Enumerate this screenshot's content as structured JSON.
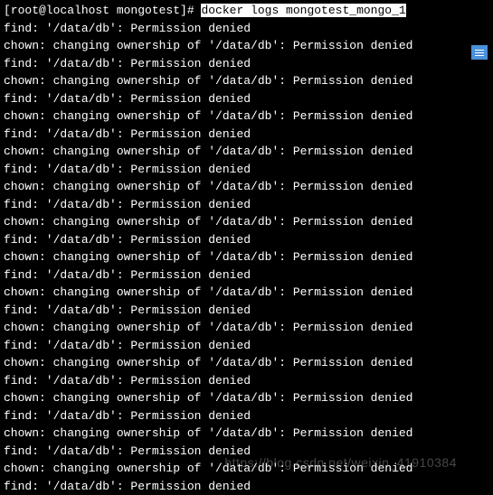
{
  "prompt": {
    "text": "[root@localhost mongotest]# ",
    "command": "docker logs mongotest_mongo_1"
  },
  "lines": [
    "find: '/data/db': Permission denied",
    "chown: changing ownership of '/data/db': Permission denied",
    "find: '/data/db': Permission denied",
    "chown: changing ownership of '/data/db': Permission denied",
    "find: '/data/db': Permission denied",
    "chown: changing ownership of '/data/db': Permission denied",
    "find: '/data/db': Permission denied",
    "chown: changing ownership of '/data/db': Permission denied",
    "find: '/data/db': Permission denied",
    "chown: changing ownership of '/data/db': Permission denied",
    "find: '/data/db': Permission denied",
    "chown: changing ownership of '/data/db': Permission denied",
    "find: '/data/db': Permission denied",
    "chown: changing ownership of '/data/db': Permission denied",
    "find: '/data/db': Permission denied",
    "chown: changing ownership of '/data/db': Permission denied",
    "find: '/data/db': Permission denied",
    "chown: changing ownership of '/data/db': Permission denied",
    "find: '/data/db': Permission denied",
    "chown: changing ownership of '/data/db': Permission denied",
    "find: '/data/db': Permission denied",
    "chown: changing ownership of '/data/db': Permission denied",
    "find: '/data/db': Permission denied",
    "chown: changing ownership of '/data/db': Permission denied",
    "find: '/data/db': Permission denied",
    "chown: changing ownership of '/data/db': Permission denied",
    "find: '/data/db': Permission denied"
  ],
  "watermark": "https://blog.csdn.net/weixin_41910384"
}
